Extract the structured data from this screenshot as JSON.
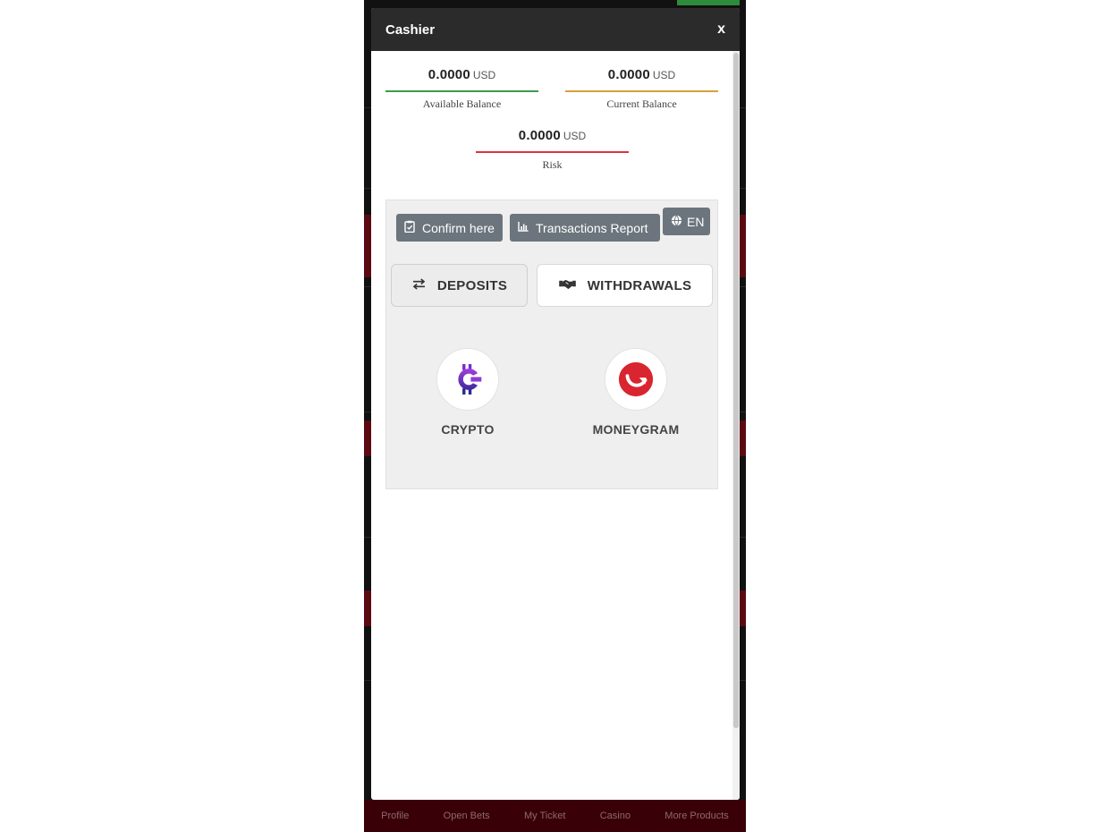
{
  "modal": {
    "title": "Cashier",
    "close_label": "x"
  },
  "balances": {
    "available": {
      "amount": "0.0000",
      "currency": "USD",
      "label": "Available Balance",
      "color": "#3d9a4c"
    },
    "current": {
      "amount": "0.0000",
      "currency": "USD",
      "label": "Current Balance",
      "color": "#d4a23a"
    },
    "risk": {
      "amount": "0.0000",
      "currency": "USD",
      "label": "Risk",
      "color": "#d9343f"
    }
  },
  "actions": {
    "confirm_label": "Confirm here",
    "confirm_icon": "clipboard-check-icon",
    "report_label": "Transactions Report",
    "report_icon": "bar-chart-icon",
    "language_label": "EN",
    "language_icon": "globe-icon"
  },
  "tabs": {
    "deposits_label": "DEPOSITS",
    "deposits_icon": "exchange-arrows-icon",
    "withdrawals_label": "WITHDRAWALS",
    "withdrawals_icon": "handshake-icon"
  },
  "methods": [
    {
      "label": "CRYPTO",
      "icon": "crypto-logo-icon",
      "color": "#6a2fc1"
    },
    {
      "label": "MONEYGRAM",
      "icon": "moneygram-logo-icon",
      "color": "#d9252f"
    }
  ],
  "bottom_nav": [
    "Profile",
    "Open Bets",
    "My Ticket",
    "Casino",
    "More Products"
  ]
}
